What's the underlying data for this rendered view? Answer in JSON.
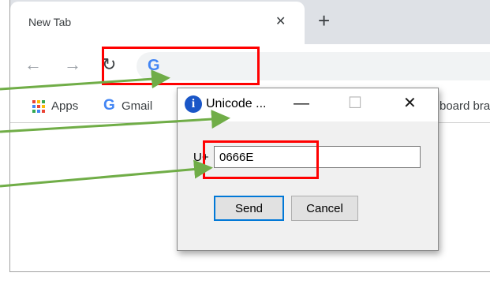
{
  "browser": {
    "tab_title": "New Tab",
    "tab_close_glyph": "✕",
    "new_tab_glyph": "+",
    "nav": {
      "back_glyph": "←",
      "forward_glyph": "→",
      "reload_glyph": "↻"
    },
    "omnibox_logo": "G",
    "bookmarks": {
      "apps_label": "Apps",
      "gmail_logo": "G",
      "gmail_label": "Gmail",
      "truncated_label": "board bra"
    }
  },
  "dialog": {
    "icon": "info-icon",
    "icon_glyph": "i",
    "title": "Unicode ...",
    "minimize_glyph": "—",
    "maximize_glyph": "☐",
    "close_glyph": "✕",
    "prefix_label": "U+",
    "input_value": "0666E",
    "send_label": "Send",
    "cancel_label": "Cancel"
  },
  "annotations": {
    "highlight_color": "#ff0000",
    "arrow_color": "#70ad47",
    "apps_colors": [
      "#ea4335",
      "#fbbc04",
      "#34a853",
      "#4285f4",
      "#ea4335",
      "#fbbc04",
      "#34a853",
      "#4285f4",
      "#ea4335"
    ]
  }
}
